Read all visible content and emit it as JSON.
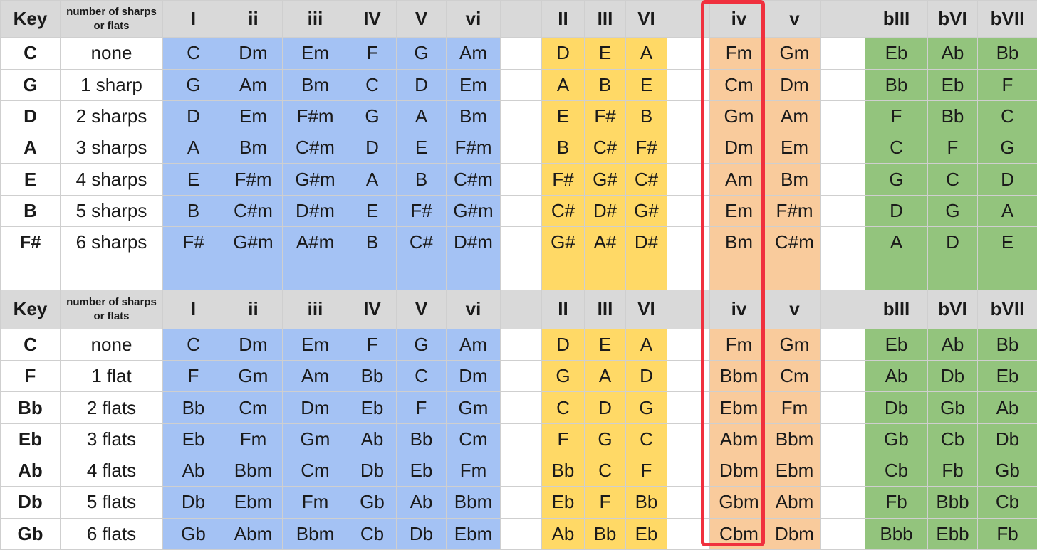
{
  "colors": {
    "blue": "#a4c2f4",
    "yellow": "#ffd966",
    "orange": "#f9cb9c",
    "green": "#93c47d",
    "header": "#d9d9d9",
    "highlight": "#f0303e"
  },
  "highlighted_column": "iv",
  "header": [
    "Key",
    "number of sharps or flats",
    "I",
    "ii",
    "iii",
    "IV",
    "V",
    "vi",
    "",
    "II",
    "III",
    "VI",
    "",
    "iv",
    "v",
    "",
    "bIII",
    "bVI",
    "bVII"
  ],
  "sharp_rows": [
    [
      "C",
      "none",
      "C",
      "Dm",
      "Em",
      "F",
      "G",
      "Am",
      "",
      "D",
      "E",
      "A",
      "",
      "Fm",
      "Gm",
      "",
      "Eb",
      "Ab",
      "Bb"
    ],
    [
      "G",
      "1 sharp",
      "G",
      "Am",
      "Bm",
      "C",
      "D",
      "Em",
      "",
      "A",
      "B",
      "E",
      "",
      "Cm",
      "Dm",
      "",
      "Bb",
      "Eb",
      "F"
    ],
    [
      "D",
      "2 sharps",
      "D",
      "Em",
      "F#m",
      "G",
      "A",
      "Bm",
      "",
      "E",
      "F#",
      "B",
      "",
      "Gm",
      "Am",
      "",
      "F",
      "Bb",
      "C"
    ],
    [
      "A",
      "3 sharps",
      "A",
      "Bm",
      "C#m",
      "D",
      "E",
      "F#m",
      "",
      "B",
      "C#",
      "F#",
      "",
      "Dm",
      "Em",
      "",
      "C",
      "F",
      "G"
    ],
    [
      "E",
      "4 sharps",
      "E",
      "F#m",
      "G#m",
      "A",
      "B",
      "C#m",
      "",
      "F#",
      "G#",
      "C#",
      "",
      "Am",
      "Bm",
      "",
      "G",
      "C",
      "D"
    ],
    [
      "B",
      "5 sharps",
      "B",
      "C#m",
      "D#m",
      "E",
      "F#",
      "G#m",
      "",
      "C#",
      "D#",
      "G#",
      "",
      "Em",
      "F#m",
      "",
      "D",
      "G",
      "A"
    ],
    [
      "F#",
      "6 sharps",
      "F#",
      "G#m",
      "A#m",
      "B",
      "C#",
      "D#m",
      "",
      "G#",
      "A#",
      "D#",
      "",
      "Bm",
      "C#m",
      "",
      "A",
      "D",
      "E"
    ]
  ],
  "flat_rows": [
    [
      "C",
      "none",
      "C",
      "Dm",
      "Em",
      "F",
      "G",
      "Am",
      "",
      "D",
      "E",
      "A",
      "",
      "Fm",
      "Gm",
      "",
      "Eb",
      "Ab",
      "Bb"
    ],
    [
      "F",
      "1 flat",
      "F",
      "Gm",
      "Am",
      "Bb",
      "C",
      "Dm",
      "",
      "G",
      "A",
      "D",
      "",
      "Bbm",
      "Cm",
      "",
      "Ab",
      "Db",
      "Eb"
    ],
    [
      "Bb",
      "2 flats",
      "Bb",
      "Cm",
      "Dm",
      "Eb",
      "F",
      "Gm",
      "",
      "C",
      "D",
      "G",
      "",
      "Ebm",
      "Fm",
      "",
      "Db",
      "Gb",
      "Ab"
    ],
    [
      "Eb",
      "3 flats",
      "Eb",
      "Fm",
      "Gm",
      "Ab",
      "Bb",
      "Cm",
      "",
      "F",
      "G",
      "C",
      "",
      "Abm",
      "Bbm",
      "",
      "Gb",
      "Cb",
      "Db"
    ],
    [
      "Ab",
      "4 flats",
      "Ab",
      "Bbm",
      "Cm",
      "Db",
      "Eb",
      "Fm",
      "",
      "Bb",
      "C",
      "F",
      "",
      "Dbm",
      "Ebm",
      "",
      "Cb",
      "Fb",
      "Gb"
    ],
    [
      "Db",
      "5 flats",
      "Db",
      "Ebm",
      "Fm",
      "Gb",
      "Ab",
      "Bbm",
      "",
      "Eb",
      "F",
      "Bb",
      "",
      "Gbm",
      "Abm",
      "",
      "Fb",
      "Bbb",
      "Cb"
    ],
    [
      "Gb",
      "6 flats",
      "Gb",
      "Abm",
      "Bbm",
      "Cb",
      "Db",
      "Ebm",
      "",
      "Ab",
      "Bb",
      "Eb",
      "",
      "Cbm",
      "Dbm",
      "",
      "Bbb",
      "Ebb",
      "Fb"
    ]
  ]
}
